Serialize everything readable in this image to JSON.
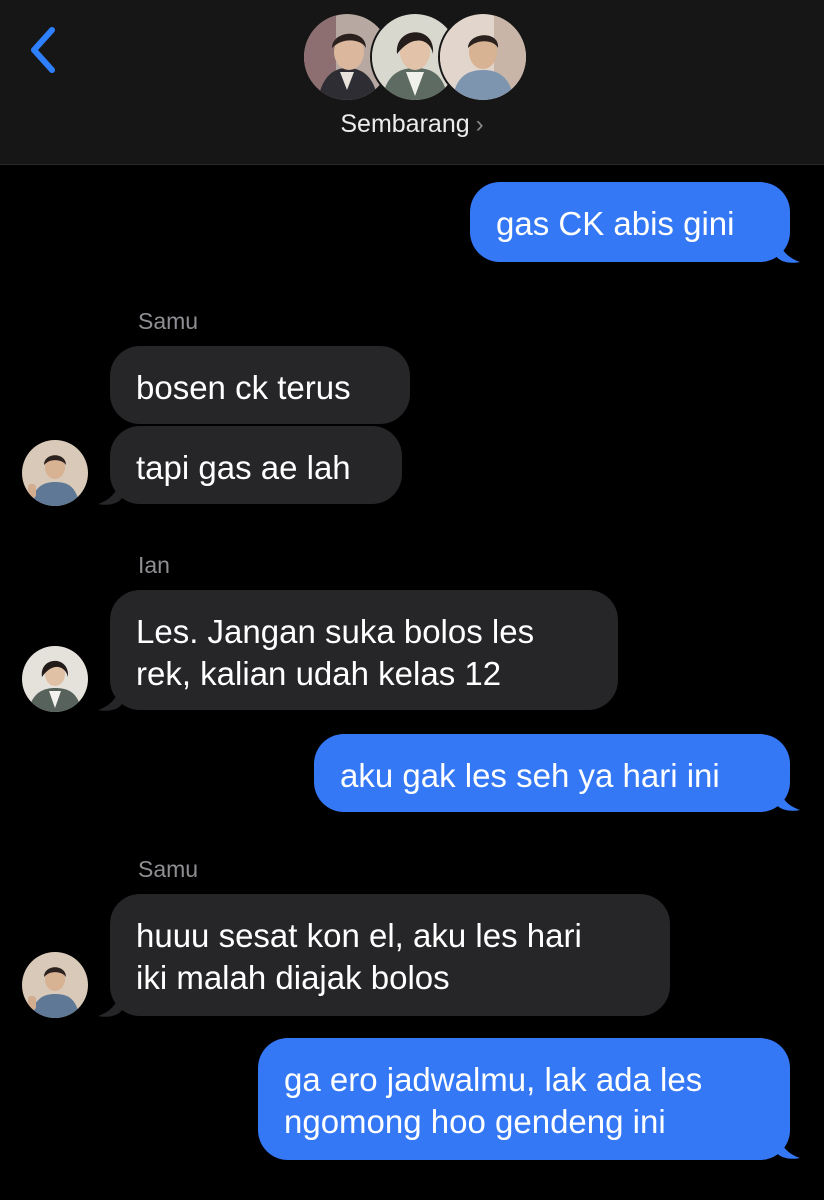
{
  "header": {
    "back_icon": "chevron-left-icon",
    "group_name": "Sembarang",
    "chevron": "›",
    "participants": [
      "participant-1",
      "participant-2",
      "participant-3"
    ]
  },
  "colors": {
    "accent": "#3478f6",
    "sent_bubble": "#3478f6",
    "received_bubble": "#262628",
    "background": "#000000",
    "header_bg": "#161616"
  },
  "messages": [
    {
      "from": "me",
      "text": "gas CK abis gini"
    },
    {
      "from": "Samu",
      "text": "bosen ck terus"
    },
    {
      "from": "Samu",
      "text": "tapi gas ae lah"
    },
    {
      "from": "Ian",
      "text": [
        "Les. Jangan suka bolos les",
        "rek, kalian udah kelas 12"
      ]
    },
    {
      "from": "me",
      "text": "aku gak les seh ya hari ini"
    },
    {
      "from": "Samu",
      "text": [
        "huuu sesat kon el, aku les hari",
        "iki malah diajak bolos"
      ]
    },
    {
      "from": "me",
      "text": [
        "ga ero jadwalmu, lak ada les",
        "ngomong hoo gendeng ini"
      ]
    }
  ],
  "senders": {
    "samu": "Samu",
    "ian": "Ian"
  }
}
